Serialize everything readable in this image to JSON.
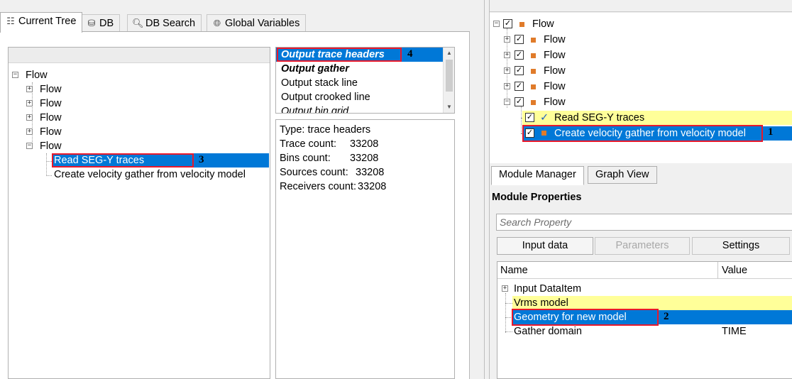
{
  "left_tabs": [
    {
      "label": "Current Tree",
      "icon": "tree-icon"
    },
    {
      "label": "DB",
      "icon": "database-icon"
    },
    {
      "label": "DB Search",
      "icon": "search-icon"
    },
    {
      "label": "Global Variables",
      "icon": "globe-icon"
    }
  ],
  "tree": {
    "root": "Flow",
    "children": [
      "Flow",
      "Flow",
      "Flow",
      "Flow",
      "Flow"
    ],
    "modules": [
      "Read SEG-Y traces",
      "Create velocity gather from velocity model"
    ]
  },
  "output_list": [
    "Output trace headers",
    "Output gather",
    "Output stack line",
    "Output crooked line",
    "Output bin grid"
  ],
  "info": {
    "type": "Type: trace headers",
    "trace_label": "Trace count:",
    "trace_val": "33208",
    "bins_label": "Bins count:",
    "bins_val": "33208",
    "sources_label": "Sources count:",
    "sources_val": "33208",
    "receivers_label": "Receivers count:",
    "receivers_val": "33208"
  },
  "flow_tree": {
    "root": "Flow",
    "children": [
      "Flow",
      "Flow",
      "Flow",
      "Flow",
      "Flow"
    ],
    "modules": [
      "Read SEG-Y traces",
      "Create velocity gather from velocity model"
    ]
  },
  "right_tabs": [
    "Module Manager",
    "Graph View"
  ],
  "module_properties": {
    "title": "Module Properties",
    "search_placeholder": "Search Property",
    "tabs": [
      "Input data",
      "Parameters",
      "Settings"
    ],
    "columns": [
      "Name",
      "Value"
    ],
    "rows": [
      {
        "name": "Input DataItem",
        "value": ""
      },
      {
        "name": "Vrms model",
        "value": ""
      },
      {
        "name": "Geometry for new model",
        "value": ""
      },
      {
        "name": "Gather domain",
        "value": "TIME"
      }
    ]
  },
  "annotations": [
    "1",
    "2",
    "3",
    "4"
  ],
  "colors": {
    "selection": "#0078d7",
    "highlight": "#ffff99",
    "annotation_box": "#e8192c",
    "module_square": "#e07b2a"
  }
}
